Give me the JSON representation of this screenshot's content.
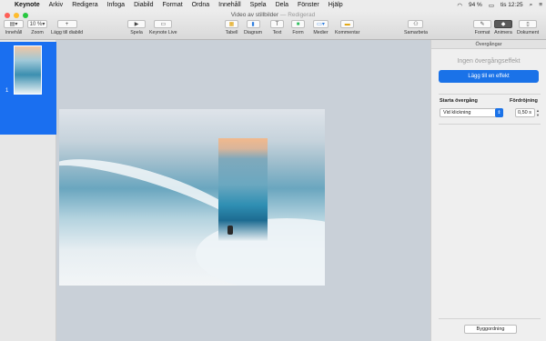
{
  "menubar": {
    "app_name": "Keynote",
    "menus": [
      "Arkiv",
      "Redigera",
      "Infoga",
      "Diabild",
      "Format",
      "Ordna",
      "Innehåll",
      "Spela",
      "Dela",
      "Fönster",
      "Hjälp"
    ],
    "battery": "94 %",
    "clock": "tis 12:25"
  },
  "window": {
    "title": "Video av stillbilder",
    "status": "— Redigerad"
  },
  "toolbar": {
    "view_label": "Innehåll",
    "zoom_value": "10 %",
    "zoom_label": "Zoom",
    "add_slide_label": "Lägg till diabild",
    "play_label": "Spela",
    "keynote_live_label": "Keynote Live",
    "table_label": "Tabell",
    "chart_label": "Diagram",
    "text_label": "Text",
    "shape_label": "Form",
    "media_label": "Medier",
    "comment_label": "Kommentar",
    "collaborate_label": "Samarbeta",
    "format_label": "Format",
    "animate_label": "Animera",
    "document_label": "Dokument"
  },
  "sidebar": {
    "slide_number": "1"
  },
  "inspector": {
    "header": "Övergångar",
    "no_effect": "Ingen övergångseffekt",
    "add_effect": "Lägg till en effekt",
    "start_transition_label": "Starta övergång",
    "start_transition_value": "Vid klickning",
    "delay_label": "Fördröjning",
    "delay_value": "0,50 s",
    "build_order": "Byggordning"
  }
}
